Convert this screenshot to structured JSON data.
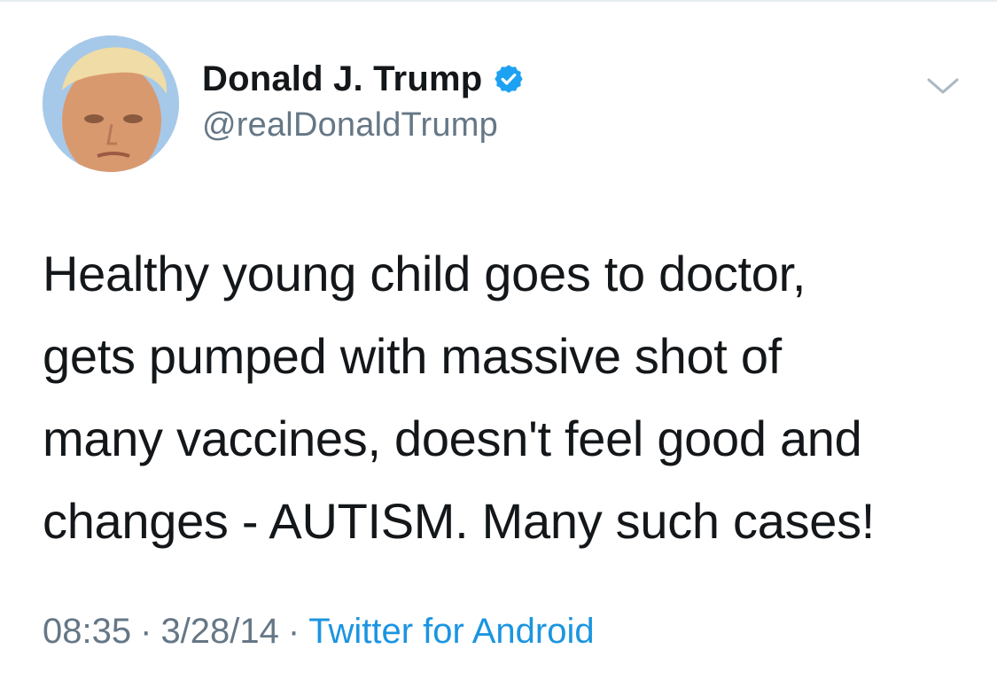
{
  "user": {
    "display_name": "Donald J. Trump",
    "handle": "@realDonaldTrump",
    "verified": true,
    "avatar_icon": "profile-photo"
  },
  "tweet": {
    "lines": [
      "Healthy young child goes to doctor,",
      "gets pumped with massive shot of",
      "many vaccines, doesn't feel good and",
      "changes - AUTISM. Many such cases!"
    ]
  },
  "meta": {
    "time": "08:35",
    "separator": "·",
    "date": "3/28/14",
    "source": "Twitter for Android"
  },
  "icons": {
    "verified": "verified-badge-icon",
    "menu": "chevron-down-icon"
  },
  "colors": {
    "text": "#14171a",
    "secondary": "#657786",
    "link": "#1b95e0",
    "verified": "#1da1f2"
  }
}
